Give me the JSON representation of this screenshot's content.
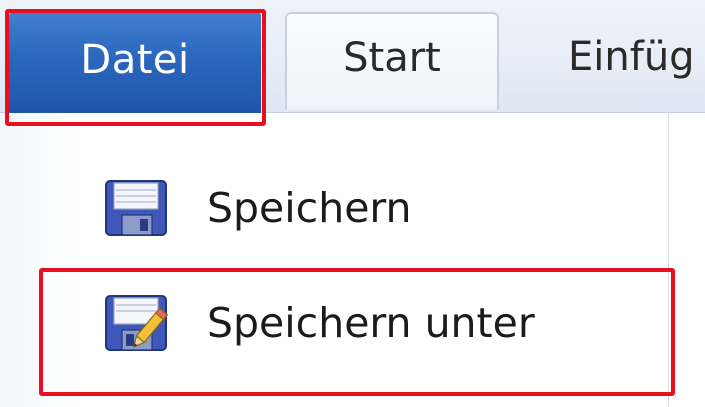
{
  "ribbon": {
    "tabs": [
      {
        "label": "Datei",
        "active": true
      },
      {
        "label": "Start",
        "active": false
      },
      {
        "label": "Einfüg",
        "active": false
      }
    ]
  },
  "file_menu": {
    "items": [
      {
        "label": "Speichern",
        "icon": "floppy-disk-icon"
      },
      {
        "label": "Speichern unter",
        "icon": "save-as-icon"
      }
    ]
  },
  "highlights": [
    "Datei",
    "Speichern unter"
  ],
  "colors": {
    "file_tab": "#2b66bd",
    "highlight": "#e8101e",
    "tab_background": "#eef3fa"
  }
}
